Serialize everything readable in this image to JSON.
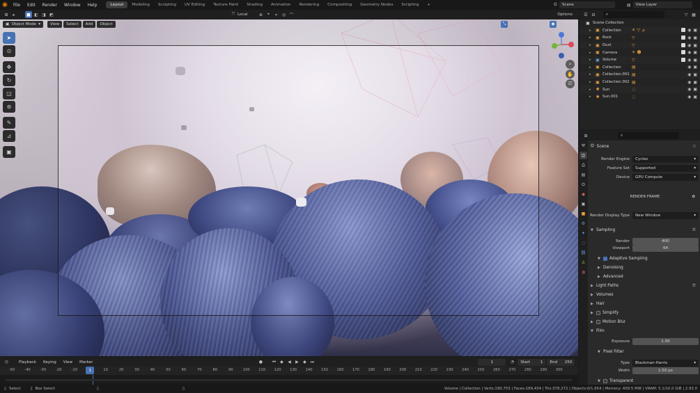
{
  "menu": {
    "items": [
      "File",
      "Edit",
      "Render",
      "Window",
      "Help"
    ],
    "workspaces": [
      "Layout",
      "Modeling",
      "Sculpting",
      "UV Editing",
      "Texture Paint",
      "Shading",
      "Animation",
      "Rendering",
      "Compositing",
      "Geometry Nodes",
      "Scripting"
    ],
    "active_workspace": "Layout",
    "add_tab": "+",
    "scene": "Scene",
    "view_layer": "View Layer"
  },
  "viewport_header": {
    "transform_space": "Local",
    "options": "Options",
    "mode": "Object Mode",
    "view": "View",
    "select": "Select",
    "add": "Add",
    "object": "Object"
  },
  "timeline": {
    "playback": "Playback",
    "keying": "Keying",
    "view": "View",
    "marker": "Marker",
    "current_frame": "1",
    "start_label": "Start",
    "start": "1",
    "end_label": "End",
    "end": "250",
    "ticks": [
      "-50",
      "-40",
      "-30",
      "-20",
      "-10",
      "1",
      "10",
      "20",
      "30",
      "40",
      "50",
      "60",
      "70",
      "80",
      "90",
      "100",
      "110",
      "120",
      "130",
      "140",
      "150",
      "160",
      "170",
      "180",
      "190",
      "200",
      "210",
      "220",
      "230",
      "240",
      "250",
      "260",
      "270",
      "280",
      "290",
      "300"
    ]
  },
  "status": {
    "select": "Select",
    "box_select": "Box Select",
    "stats": "Volume | Collection | Verts:190,753 | Faces:189,434 | Tris:378,272 | Objects:0/1,654 | Memory: 409.5 MiB | VRAM: 5.1/10.0 GiB | 2.93.0"
  },
  "outliner": {
    "root": "Scene Collection",
    "items": [
      {
        "name": "Collection",
        "icon": "collection-icon"
      },
      {
        "name": "Rock",
        "icon": "collection-icon"
      },
      {
        "name": "Dust",
        "icon": "collection-icon"
      },
      {
        "name": "Camera",
        "icon": "collection-icon"
      },
      {
        "name": "Volume",
        "icon": "collection-icon"
      },
      {
        "name": "Collection",
        "icon": "collection-icon"
      },
      {
        "name": "Collection.001",
        "icon": "collection-icon"
      },
      {
        "name": "Collection.002",
        "icon": "collection-icon"
      },
      {
        "name": "Sun",
        "icon": "light-icon"
      },
      {
        "name": "Sun.001",
        "icon": "light-icon"
      }
    ]
  },
  "properties": {
    "context": "Scene",
    "render_engine_label": "Render Engine",
    "render_engine": "Cycles",
    "feature_set_label": "Feature Set",
    "feature_set": "Supported",
    "device_label": "Device",
    "device": "GPU Compute",
    "render_frame": "RENDER FRAME",
    "display_type_label": "Render Display Type",
    "display_type": "New Window",
    "sampling": "Sampling",
    "render_label": "Render",
    "render_samples": "400",
    "viewport_label": "Viewport",
    "viewport_samples": "64",
    "adaptive_sampling": "Adaptive Sampling",
    "denoising": "Denoising",
    "advanced": "Advanced",
    "light_paths": "Light Paths",
    "volumes": "Volumes",
    "hair": "Hair",
    "simplify": "Simplify",
    "motion_blur": "Motion Blur",
    "film": "Film",
    "exposure_label": "Exposure",
    "exposure": "1.00",
    "pixel_filter": "Pixel Filter",
    "type_label": "Type",
    "type": "Blackman-Harris",
    "width_label": "Width",
    "width": "1.50 px",
    "transparent": "Transparent"
  },
  "colors": {
    "accent": "#4772b3",
    "blender_orange": "#e87d0d"
  }
}
